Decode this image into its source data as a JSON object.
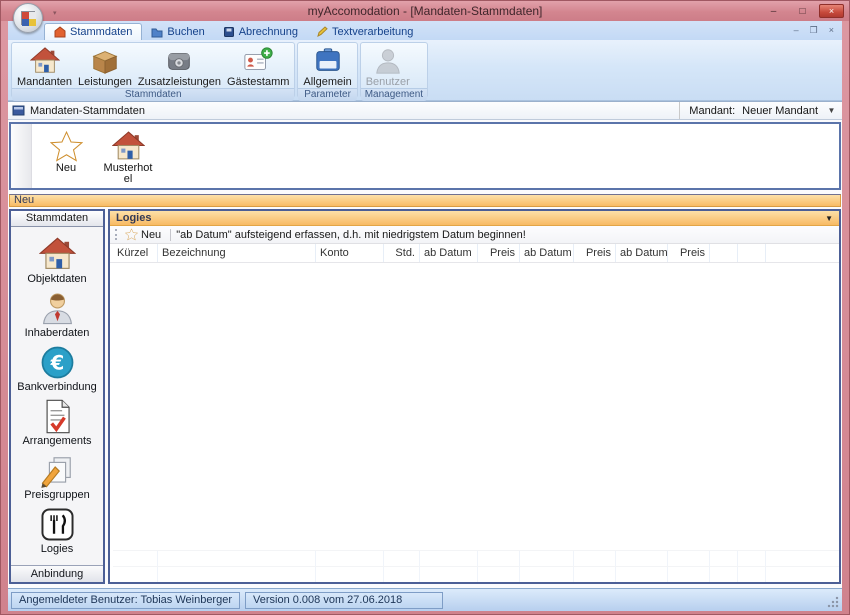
{
  "window": {
    "title": "myAccomodation - [Mandaten-Stammdaten]"
  },
  "icons": {
    "minimize": "–",
    "maximize": "□",
    "close": "×",
    "mdi_minimize": "–",
    "mdi_restore": "❐",
    "mdi_close": "×",
    "dropdown": "▼",
    "qat_dropdown": "▾"
  },
  "ribbon": {
    "tabs": [
      {
        "label": "Stammdaten",
        "active": true
      },
      {
        "label": "Buchen",
        "active": false
      },
      {
        "label": "Abrechnung",
        "active": false
      },
      {
        "label": "Textverarbeitung",
        "active": false
      }
    ],
    "groups": [
      {
        "label": "Stammdaten",
        "buttons": [
          {
            "label": "Mandanten",
            "icon": "house-icon"
          },
          {
            "label": "Leistungen",
            "icon": "package-icon"
          },
          {
            "label": "Zusatzleistungen",
            "icon": "wallet-icon"
          },
          {
            "label": "Gästestamm",
            "icon": "person-card-plus-icon"
          }
        ]
      },
      {
        "label": "Parameter",
        "buttons": [
          {
            "label": "Allgemein",
            "icon": "blue-folder-icon"
          }
        ]
      },
      {
        "label": "Management",
        "buttons": [
          {
            "label": "Benutzer",
            "icon": "user-gray-icon",
            "disabled": true
          }
        ]
      }
    ]
  },
  "mdi": {
    "caption": "Mandaten-Stammdaten",
    "mandant_label": "Mandant:",
    "mandant_value": "Neuer Mandant"
  },
  "mandant_toolbar": {
    "items": [
      {
        "label": "Neu",
        "icon": "star-icon"
      },
      {
        "label": "Musterhotel",
        "icon": "house-icon"
      }
    ]
  },
  "selection_bar": {
    "label": "Neu"
  },
  "sidebar": {
    "header": "Stammdaten",
    "items": [
      {
        "label": "Objektdaten",
        "icon": "house-icon"
      },
      {
        "label": "Inhaberdaten",
        "icon": "person-icon"
      },
      {
        "label": "Bankverbindung",
        "icon": "euro-icon"
      },
      {
        "label": "Arrangements",
        "icon": "document-check-icon"
      },
      {
        "label": "Preisgruppen",
        "icon": "pages-pencil-icon"
      },
      {
        "label": "Logies",
        "icon": "cutlery-icon"
      }
    ],
    "footer": "Anbindung"
  },
  "logies_panel": {
    "header": "Logies",
    "new_button": "Neu",
    "hint": "\"ab Datum\" aufsteigend erfassen, d.h. mit niedrigstem Datum beginnen!",
    "columns": [
      "Kürzel",
      "Bezeichnung",
      "Konto",
      "Std.",
      "ab Datum",
      "Preis",
      "ab Datum",
      "Preis",
      "ab Datum",
      "Preis"
    ]
  },
  "statusbar": {
    "user": "Angemeldeter Benutzer: Tobias Weinberger",
    "version": "Version 0.008 vom 27.06.2018"
  },
  "colors": {
    "titlebar": "#d3858f",
    "ribbon_bg": "#d5e6f8",
    "tab_text": "#15428b",
    "orange_bar": "#f8bb66",
    "panel_border": "#4c5f96",
    "close_button": "#c74a3c",
    "status_panel": "#bdd5f1"
  }
}
